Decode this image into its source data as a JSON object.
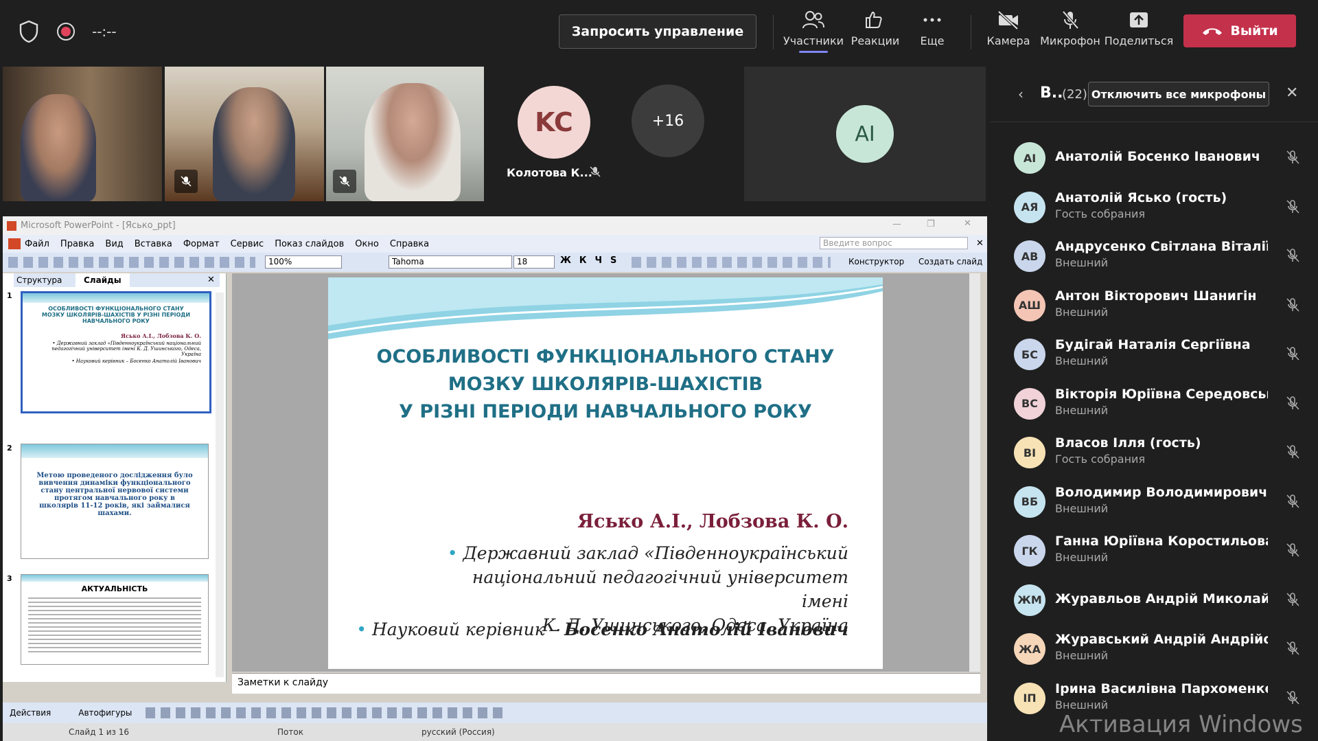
{
  "topbar": {
    "timer": "--:--",
    "request_control": "Запросить управление",
    "tools": [
      {
        "label": "Участники",
        "icon": "participants-icon"
      },
      {
        "label": "Реакции",
        "icon": "reactions-icon"
      },
      {
        "label": "Еще",
        "icon": "more-icon"
      },
      {
        "label": "Камера",
        "icon": "camera-off-icon"
      },
      {
        "label": "Микрофон",
        "icon": "mic-off-icon"
      },
      {
        "label": "Поделиться",
        "icon": "share-icon"
      }
    ],
    "leave": "Выйти",
    "leave_color": "#c4314b"
  },
  "videos": {
    "kc_initials": "KC",
    "kc_name": "Колотова К...",
    "more_count": "+16",
    "ai_initials": "AI"
  },
  "ppt": {
    "title": "Microsoft PowerPoint - [Ясько_ppt]",
    "menu": [
      "Файл",
      "Правка",
      "Вид",
      "Вставка",
      "Формат",
      "Сервис",
      "Показ слайдов",
      "Окно",
      "Справка"
    ],
    "help_placeholder": "Введите вопрос",
    "zoom": "100%",
    "font": "Tahoma",
    "font_size": "18",
    "designer": "Конструктор",
    "new_slide": "Создать слайд",
    "tabs": [
      "Структура",
      "Слайды"
    ],
    "thumbs": [
      {
        "num": "1",
        "title": "ОСОБЛИВОСТІ ФУНКЦІОНАЛЬНОГО СТАНУ МОЗКУ ШКОЛЯРІВ-ШАХІСТІВ У РІЗНІ ПЕРІОДИ НАВЧАЛЬНОГО РОКУ",
        "authors": "Ясько А.І., Лобзова К. О.",
        "lines": [
          "• Державний заклад «Південноукраїнський національний педагогічний університет імені К. Д. Ушинського, Одеса, Україна",
          "• Науковий керівник – Босенко Анатолій Іванович"
        ]
      },
      {
        "num": "2",
        "text": "Метою проведеного дослідження було вивчення динаміки функціонального стану центральної нервової системи протягом навчального року в школярів 11-12 років, які займалися шахами."
      },
      {
        "num": "3",
        "title": "АКТУАЛЬНІСТЬ"
      }
    ],
    "slide": {
      "title_lines": [
        "ОСОБЛИВОСТІ ФУНКЦІОНАЛЬНОГО СТАНУ",
        "МОЗКУ ШКОЛЯРІВ-ШАХІСТІВ",
        "У РІЗНІ ПЕРІОДИ НАВЧАЛЬНОГО РОКУ"
      ],
      "authors": "Ясько А.І., Лобзова К. О.",
      "inst_lines": [
        "Державний заклад «Південноукраїнський",
        "національний педагогічний університет імені",
        "К. Д. Ушинського, Одеса, Україна"
      ],
      "supervisor_prefix": "Науковий керівник – ",
      "supervisor_name": "Босенко Анатолій Іванович",
      "title_color": "#1f6f86"
    },
    "notes": "Заметки к слайду",
    "draw": {
      "actions": "Действия",
      "autoshapes": "Автофигуры"
    },
    "status": {
      "slide": "Слайд 1 из 16",
      "design": "Поток",
      "lang": "русский (Россия)"
    }
  },
  "panel": {
    "header": "В..",
    "count": "(22)",
    "mute_all": "Отключить все микрофоны",
    "participants": [
      {
        "initials": "AI",
        "name": "Анатолій Босенко Іванович",
        "sub": "",
        "color": "#c8e6d8"
      },
      {
        "initials": "АЯ",
        "name": "Анатолій Ясько (гость)",
        "sub": "Гость собрания",
        "color": "#c6e4f0"
      },
      {
        "initials": "АВ",
        "name": "Андрусенко Світлана Віталіївна",
        "sub": "Внешний",
        "color": "#c9d6ec"
      },
      {
        "initials": "АШ",
        "name": "Антон Вікторович Шанигін",
        "sub": "Внешний",
        "color": "#f4c5b5"
      },
      {
        "initials": "БС",
        "name": "Будігай Наталія Сергіївна",
        "sub": "Внешний",
        "color": "#c9d6ec"
      },
      {
        "initials": "ВС",
        "name": "Вікторія Юріївна Середовська",
        "sub": "Внешний",
        "color": "#f0d2d8"
      },
      {
        "initials": "ВІ",
        "name": "Власов Ілля (гость)",
        "sub": "Гость собрания",
        "color": "#f6e2b5"
      },
      {
        "initials": "ВБ",
        "name": "Володимир Володимирович Б...",
        "sub": "Внешний",
        "color": "#c6e4f0"
      },
      {
        "initials": "ГК",
        "name": "Ганна Юріївна Коростильова",
        "sub": "Внешний",
        "color": "#c9d6ec"
      },
      {
        "initials": "ЖМ",
        "name": "Журавльов Андрій Миколайов...",
        "sub": "",
        "color": "#c6e4f0"
      },
      {
        "initials": "ЖА",
        "name": "Журавський Андрій Андрійович",
        "sub": "Внешний",
        "color": "#f6d6b8"
      },
      {
        "initials": "ІП",
        "name": "Ірина Василівна Пархоменко",
        "sub": "Внешний",
        "color": "#f6e2b5"
      }
    ],
    "watermark": "Активация Windows"
  }
}
